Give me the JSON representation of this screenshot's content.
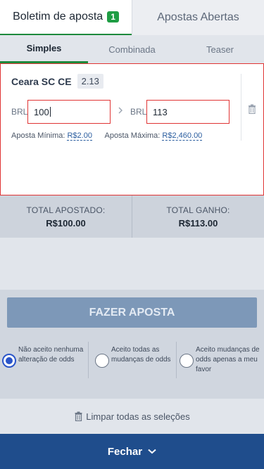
{
  "tabs": {
    "betslip_label": "Boletim de aposta",
    "betslip_count": "1",
    "open_bets_label": "Apostas Abertas"
  },
  "subtabs": {
    "single": "Simples",
    "combined": "Combinada",
    "teaser": "Teaser"
  },
  "selection": {
    "team": "Ceara SC CE",
    "odds": "2.13"
  },
  "stake": {
    "currency_label": "BRL",
    "value": "100"
  },
  "payout": {
    "currency_label": "BRL",
    "value": "113"
  },
  "limits": {
    "min_label": "Aposta Mínima:",
    "min_value": "R$2.00",
    "max_label": "Aposta Máxima:",
    "max_value": "R$2,460.00"
  },
  "totals": {
    "staked_label": "TOTAL APOSTADO:",
    "staked_value": "R$100.00",
    "win_label": "TOTAL GANHO:",
    "win_value": "R$113.00"
  },
  "place_bet_label": "FAZER APOSTA",
  "odds_change_options": [
    {
      "text": "Não aceito nenhuma alteração de odds",
      "selected": true
    },
    {
      "text": "Aceito todas as mudanças de odds",
      "selected": false
    },
    {
      "text": "Aceito mudanças de odds apenas a meu favor",
      "selected": false
    }
  ],
  "clear_all_label": "Limpar todas as seleções",
  "close_label": "Fechar",
  "colors": {
    "accent_green": "#1e8a3d",
    "error_red": "#e03434",
    "primary_blue": "#1f4d8c",
    "button_disabled": "#7d98b8"
  }
}
